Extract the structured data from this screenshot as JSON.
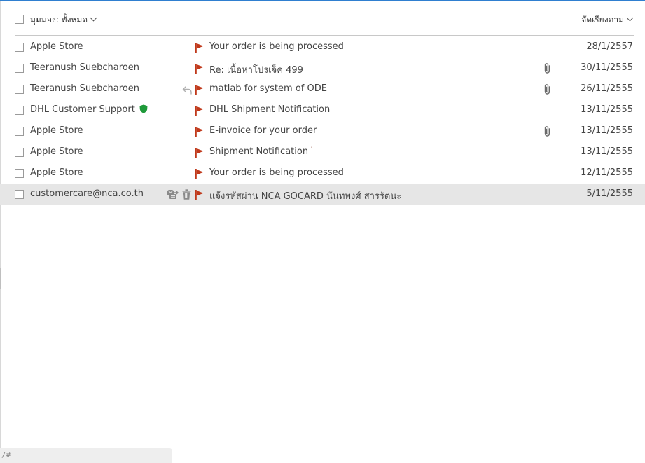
{
  "header": {
    "view_label": "มุมมอง: ทั้งหมด",
    "sort_label": "จัดเรียงตาม"
  },
  "colors": {
    "accent": "#2f7fd0",
    "flag": "#c0391b",
    "shield": "#1f9a3a",
    "selected_row": "#e6e6e6"
  },
  "messages": [
    {
      "sender": "Apple Store",
      "subject": "Your order is being processed",
      "date": "28/1/2557",
      "attachment": false,
      "replied": false,
      "verified": false,
      "selected": false
    },
    {
      "sender": "Teeranush Suebcharoen",
      "subject": "Re: เนื้อหาโปรเจ็ค 499",
      "date": "30/11/2555",
      "attachment": true,
      "replied": false,
      "verified": false,
      "selected": false
    },
    {
      "sender": "Teeranush Suebcharoen",
      "subject": "matlab for system of ODE",
      "date": "26/11/2555",
      "attachment": true,
      "replied": true,
      "verified": false,
      "selected": false
    },
    {
      "sender": "DHL Customer Support",
      "subject": "DHL Shipment Notification",
      "date": "13/11/2555",
      "attachment": false,
      "replied": false,
      "verified": true,
      "selected": false
    },
    {
      "sender": "Apple Store",
      "subject": "E-invoice for your order",
      "date": "13/11/2555",
      "attachment": true,
      "replied": false,
      "verified": false,
      "selected": false
    },
    {
      "sender": "Apple Store",
      "subject": "Shipment Notification",
      "subject_mark": "'",
      "date": "13/11/2555",
      "attachment": false,
      "replied": false,
      "verified": false,
      "selected": false
    },
    {
      "sender": "Apple Store",
      "subject": "Your order is being processed",
      "date": "12/11/2555",
      "attachment": false,
      "replied": false,
      "verified": false,
      "selected": false
    },
    {
      "sender": "customercare@nca.co.th",
      "subject": "แจ้งรหัสผ่าน NCA GOCARD นันทพงศ์ สารรัตนะ",
      "date": "5/11/2555",
      "attachment": false,
      "replied": false,
      "verified": false,
      "selected": true
    }
  ],
  "status_bar": {
    "text": "/#"
  }
}
